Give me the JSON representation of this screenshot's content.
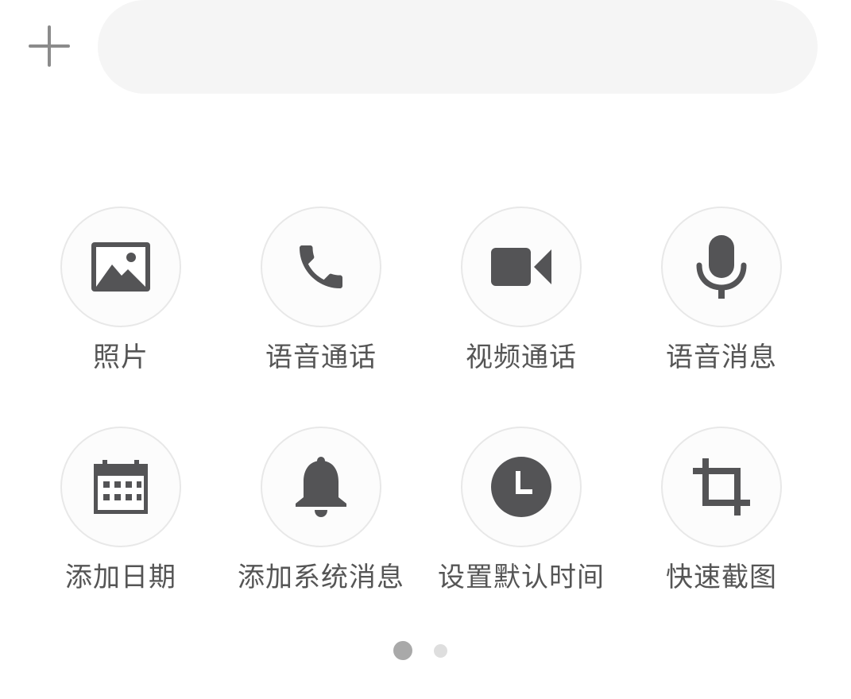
{
  "input": {
    "value": "",
    "placeholder": ""
  },
  "icon_color": "#545456",
  "actions": [
    {
      "label": "照片",
      "icon": "image-icon"
    },
    {
      "label": "语音通话",
      "icon": "phone-icon"
    },
    {
      "label": "视频通话",
      "icon": "video-camera-icon"
    },
    {
      "label": "语音消息",
      "icon": "microphone-icon"
    },
    {
      "label": "添加日期",
      "icon": "calendar-icon"
    },
    {
      "label": "添加系统消息",
      "icon": "bell-icon"
    },
    {
      "label": "设置默认时间",
      "icon": "clock-icon"
    },
    {
      "label": "快速截图",
      "icon": "crop-icon"
    }
  ],
  "pagination": {
    "total_pages": 2,
    "current_page": 1
  }
}
